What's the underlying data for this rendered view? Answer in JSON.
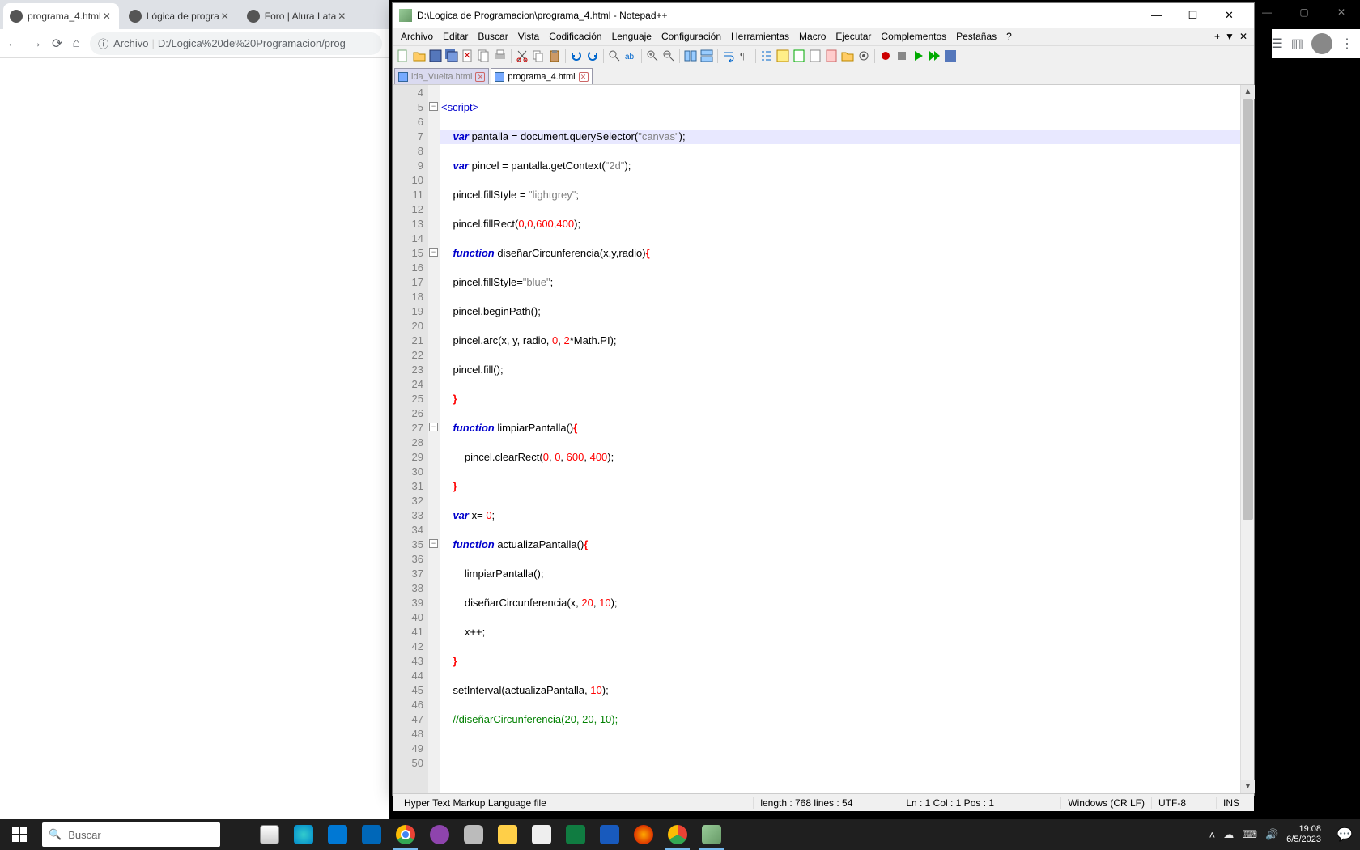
{
  "chrome": {
    "tabs": [
      {
        "title": "programa_4.html",
        "active": true
      },
      {
        "title": "Lógica de progra",
        "active": false
      },
      {
        "title": "Foro | Alura Lata",
        "active": false
      }
    ],
    "url_prefix": "Archivo",
    "url": "D:/Logica%20de%20Programacion/prog"
  },
  "npp": {
    "title": "D:\\Logica de Programacion\\programa_4.html - Notepad++",
    "menus": [
      "Archivo",
      "Editar",
      "Buscar",
      "Vista",
      "Codificación",
      "Lenguaje",
      "Configuración",
      "Herramientas",
      "Macro",
      "Ejecutar",
      "Complementos",
      "Pestañas",
      "?"
    ],
    "filetabs": [
      {
        "name": "ida_Vuelta.html",
        "active": false
      },
      {
        "name": "programa_4.html",
        "active": true
      }
    ],
    "status": {
      "filetype": "Hyper Text Markup Language file",
      "length": "length : 768    lines : 54",
      "pos": "Ln : 1    Col : 1    Pos : 1",
      "eol": "Windows (CR LF)",
      "enc": "UTF-8",
      "ovr": "INS"
    },
    "first_line_number": 4,
    "code_lines": [
      {
        "n": 4,
        "html": ""
      },
      {
        "n": 5,
        "fold": "-",
        "html": "<span class='tag'>&lt;script&gt;</span>"
      },
      {
        "n": 6,
        "html": ""
      },
      {
        "n": 7,
        "hl": true,
        "html": "    <span class='kw'>var</span> pantalla = document.querySelector(<span class='str'>\"canvas\"</span>);"
      },
      {
        "n": 8,
        "html": ""
      },
      {
        "n": 9,
        "html": "    <span class='kw'>var</span> pincel = pantalla.getContext(<span class='str'>\"2d\"</span>);"
      },
      {
        "n": 10,
        "html": ""
      },
      {
        "n": 11,
        "html": "    pincel.fillStyle = <span class='str'>\"lightgrey\"</span>;"
      },
      {
        "n": 12,
        "html": ""
      },
      {
        "n": 13,
        "html": "    pincel.fillRect(<span class='num'>0</span>,<span class='num'>0</span>,<span class='num'>600</span>,<span class='num'>400</span>);"
      },
      {
        "n": 14,
        "html": ""
      },
      {
        "n": 15,
        "fold": "-",
        "html": "    <span class='kw'>function</span> diseñarCircunferencia(x,y,radio)<span class='punct2'>{</span>"
      },
      {
        "n": 16,
        "html": ""
      },
      {
        "n": 17,
        "html": "    pincel.fillStyle=<span class='str'>\"blue\"</span>;"
      },
      {
        "n": 18,
        "html": ""
      },
      {
        "n": 19,
        "html": "    pincel.beginPath();"
      },
      {
        "n": 20,
        "html": ""
      },
      {
        "n": 21,
        "html": "    pincel.arc(x, y, radio, <span class='num'>0</span>, <span class='num'>2</span>*Math.PI);"
      },
      {
        "n": 22,
        "html": ""
      },
      {
        "n": 23,
        "html": "    pincel.fill();"
      },
      {
        "n": 24,
        "html": ""
      },
      {
        "n": 25,
        "html": "    <span class='punct2'>}</span>"
      },
      {
        "n": 26,
        "html": ""
      },
      {
        "n": 27,
        "fold": "-",
        "html": "    <span class='kw'>function</span> limpiarPantalla()<span class='punct2'>{</span>"
      },
      {
        "n": 28,
        "html": ""
      },
      {
        "n": 29,
        "html": "        pincel.clearRect(<span class='num'>0</span>, <span class='num'>0</span>, <span class='num'>600</span>, <span class='num'>400</span>);"
      },
      {
        "n": 30,
        "html": ""
      },
      {
        "n": 31,
        "html": "    <span class='punct2'>}</span>"
      },
      {
        "n": 32,
        "html": ""
      },
      {
        "n": 33,
        "html": "    <span class='kw'>var</span> x= <span class='num'>0</span>;"
      },
      {
        "n": 34,
        "html": ""
      },
      {
        "n": 35,
        "fold": "-",
        "html": "    <span class='kw'>function</span> actualizaPantalla()<span class='punct2'>{</span>"
      },
      {
        "n": 36,
        "html": ""
      },
      {
        "n": 37,
        "html": "        limpiarPantalla();"
      },
      {
        "n": 38,
        "html": ""
      },
      {
        "n": 39,
        "html": "        diseñarCircunferencia(x, <span class='num'>20</span>, <span class='num'>10</span>);"
      },
      {
        "n": 40,
        "html": ""
      },
      {
        "n": 41,
        "html": "        x++;"
      },
      {
        "n": 42,
        "html": ""
      },
      {
        "n": 43,
        "html": "    <span class='punct2'>}</span>"
      },
      {
        "n": 44,
        "html": ""
      },
      {
        "n": 45,
        "html": "    setInterval(actualizaPantalla, <span class='num'>10</span>);"
      },
      {
        "n": 46,
        "html": ""
      },
      {
        "n": 47,
        "html": "    <span class='cmt'>//diseñarCircunferencia(20, 20, 10);</span>"
      },
      {
        "n": 48,
        "html": ""
      },
      {
        "n": 49,
        "html": ""
      },
      {
        "n": 50,
        "html": ""
      }
    ]
  },
  "taskbar": {
    "search_placeholder": "Buscar",
    "time": "19:08",
    "date": "6/5/2023"
  }
}
